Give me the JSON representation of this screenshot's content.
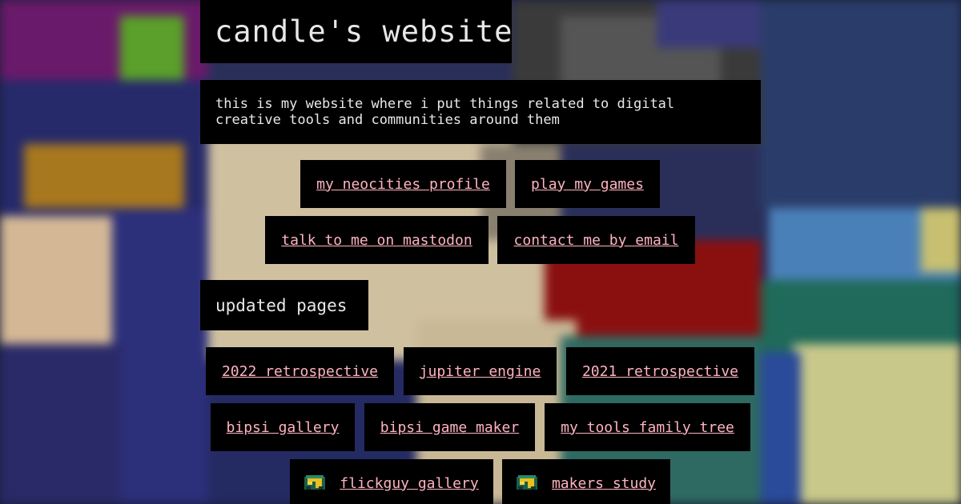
{
  "site": {
    "title": "candle's website",
    "description": "this is my website where i put things related to digital creative tools and communities around them"
  },
  "links": [
    {
      "label": "my neocities profile"
    },
    {
      "label": "play my games"
    },
    {
      "label": "talk to me on mastodon"
    },
    {
      "label": "contact me by email"
    }
  ],
  "updated": {
    "heading": "updated pages",
    "pages": [
      {
        "label": "2022 retrospective"
      },
      {
        "label": "jupiter engine"
      },
      {
        "label": "2021 retrospective"
      },
      {
        "label": "bipsi gallery"
      },
      {
        "label": "bipsi game maker"
      },
      {
        "label": "my tools family tree"
      },
      {
        "label": "flickguy gallery",
        "icon": "flickguy-icon"
      },
      {
        "label": "makers study",
        "icon": "flickguy-icon"
      }
    ]
  },
  "colors": {
    "link": "#ffb3c1",
    "box_bg": "#000000",
    "text": "#e8e8e8"
  }
}
